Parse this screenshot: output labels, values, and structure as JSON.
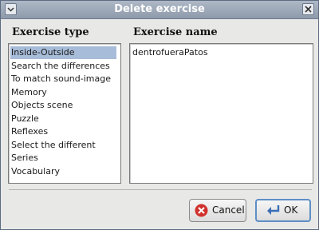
{
  "window": {
    "title": "Delete exercise"
  },
  "left": {
    "header": "Exercise type",
    "items": [
      "Inside-Outside",
      "Search the differences",
      "To match sound-image",
      "Memory",
      "Objects scene",
      "Puzzle",
      "Reflexes",
      "Select the different",
      "Series",
      "Vocabulary"
    ],
    "selected_index": 0
  },
  "right": {
    "header": "Exercise name",
    "items": [
      "dentrofueraPatos"
    ]
  },
  "buttons": {
    "cancel": "Cancel",
    "ok": "OK"
  },
  "colors": {
    "selection": "#a7bcd8",
    "cancel_icon": "#d0312d",
    "ok_border": "#5d8fc6"
  }
}
